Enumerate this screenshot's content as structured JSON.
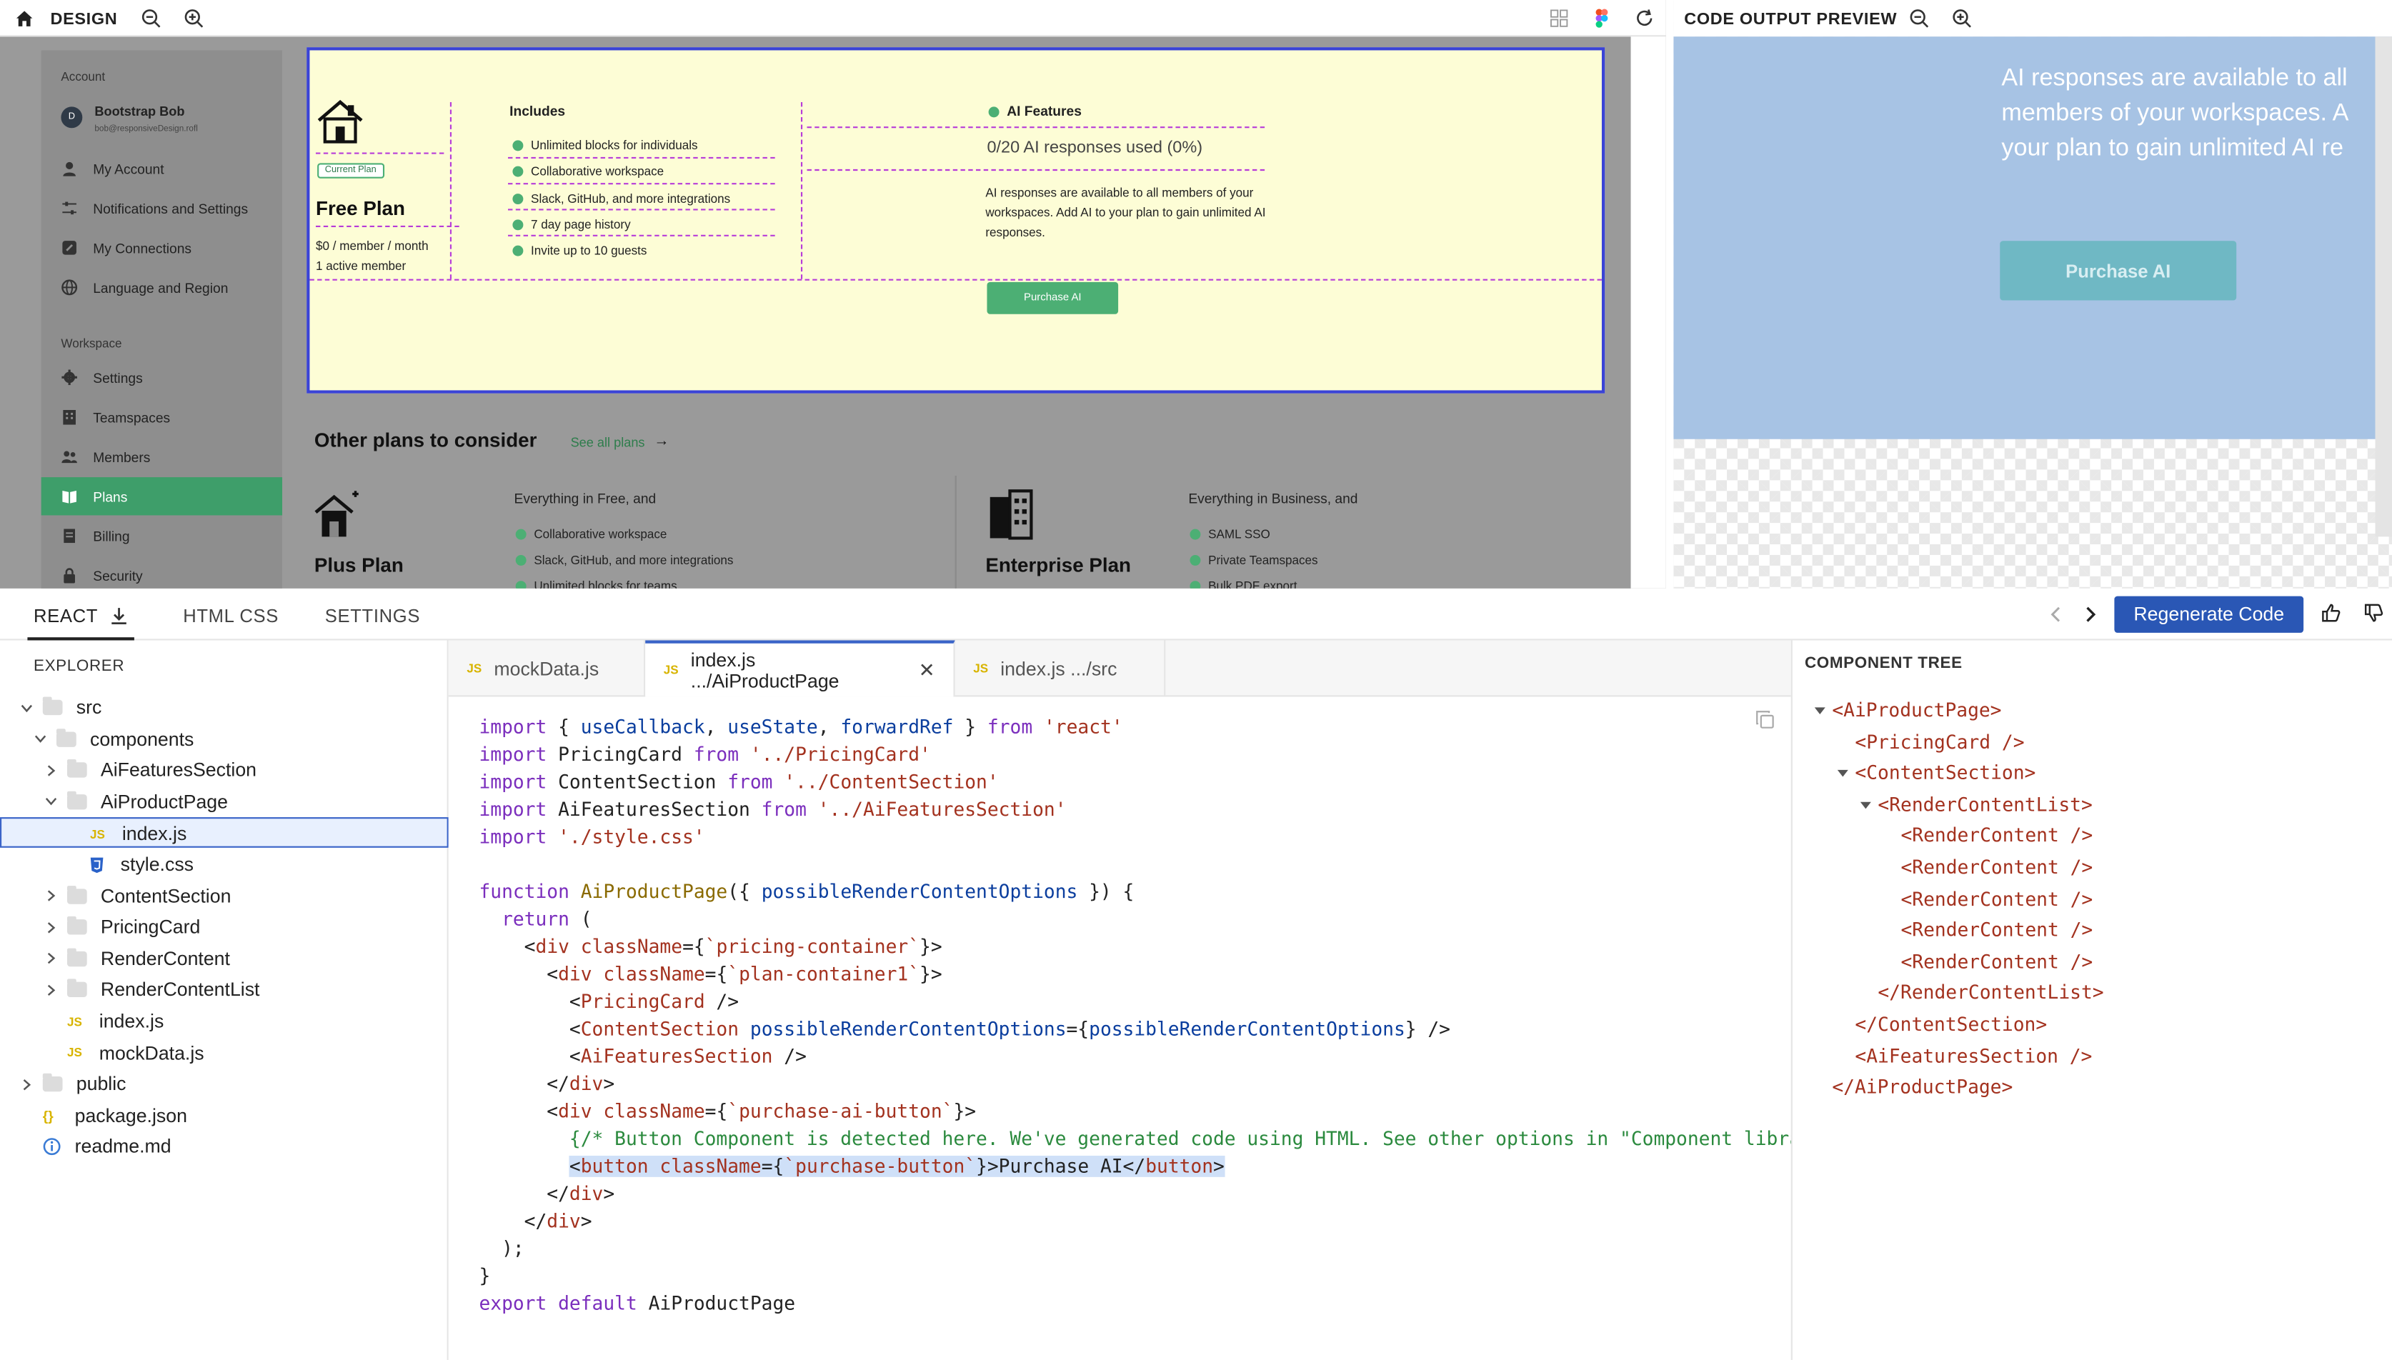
{
  "design": {
    "title": "DESIGN",
    "sidebar": {
      "account_heading": "Account",
      "user_name": "Bootstrap Bob",
      "user_email": "bob@responsiveDesign.rofl",
      "avatar_letter": "D",
      "account_items": [
        {
          "label": "My Account",
          "icon": "user-icon"
        },
        {
          "label": "Notifications and Settings",
          "icon": "sliders-icon"
        },
        {
          "label": "My Connections",
          "icon": "link-box-icon"
        },
        {
          "label": "Language and Region",
          "icon": "globe-icon"
        }
      ],
      "workspace_heading": "Workspace",
      "workspace_items": [
        {
          "label": "Settings",
          "icon": "gear-icon"
        },
        {
          "label": "Teamspaces",
          "icon": "building-icon"
        },
        {
          "label": "Members",
          "icon": "people-icon"
        },
        {
          "label": "Plans",
          "icon": "book-icon",
          "active": true
        },
        {
          "label": "Billing",
          "icon": "receipt-icon"
        },
        {
          "label": "Security",
          "icon": "lock-icon"
        }
      ]
    },
    "plan_card": {
      "badge": "Current Plan",
      "plan_name": "Free Plan",
      "price": "$0 / member / month",
      "members": "1 active member",
      "includes_title": "Includes",
      "includes": [
        "Unlimited blocks for individuals",
        "Collaborative workspace",
        "Slack, GitHub, and more integrations",
        "7 day page history",
        "Invite up to 10 guests"
      ],
      "ai_title": "AI Features",
      "ai_usage": "0/20 AI responses used (0%)",
      "ai_desc": "AI responses are available to all members of your workspaces. Add AI to your plan to gain unlimited AI responses.",
      "purchase_label": "Purchase AI"
    },
    "other_plans": {
      "title": "Other plans to consider",
      "see_all": "See all plans",
      "plus": {
        "name": "Plus Plan",
        "heading": "Everything in Free, and",
        "items": [
          "Collaborative workspace",
          "Slack, GitHub, and more integrations",
          "Unlimited blocks for teams"
        ]
      },
      "enterprise": {
        "name": "Enterprise Plan",
        "heading": "Everything in Business, and",
        "items": [
          "SAML SSO",
          "Private Teamspaces",
          "Bulk PDF export"
        ]
      }
    }
  },
  "preview": {
    "title": "CODE OUTPUT PREVIEW",
    "text_lines": [
      "AI responses are available to all",
      "members of your workspaces. A",
      "your plan to gain unlimited AI re"
    ],
    "button": "Purchase AI"
  },
  "lower_tabs": {
    "react": "REACT",
    "html_css": "HTML CSS",
    "settings": "SETTINGS",
    "regenerate": "Regenerate Code"
  },
  "explorer": {
    "title": "EXPLORER",
    "rows": [
      {
        "label": "src",
        "type": "folder",
        "level": 0,
        "open": true
      },
      {
        "label": "components",
        "type": "folder",
        "level": 1,
        "open": true
      },
      {
        "label": "AiFeaturesSection",
        "type": "folder",
        "level": 2,
        "open": false
      },
      {
        "label": "AiProductPage",
        "type": "folder",
        "level": 2,
        "open": true
      },
      {
        "label": "index.js",
        "type": "js",
        "level": 3,
        "selected": true
      },
      {
        "label": "style.css",
        "type": "css",
        "level": 3
      },
      {
        "label": "ContentSection",
        "type": "folder",
        "level": 2,
        "open": false
      },
      {
        "label": "PricingCard",
        "type": "folder",
        "level": 2,
        "open": false
      },
      {
        "label": "RenderContent",
        "type": "folder",
        "level": 2,
        "open": false
      },
      {
        "label": "RenderContentList",
        "type": "folder",
        "level": 2,
        "open": false
      },
      {
        "label": "index.js",
        "type": "js",
        "level": 2
      },
      {
        "label": "mockData.js",
        "type": "js",
        "level": 2
      },
      {
        "label": "public",
        "type": "folder",
        "level": 0,
        "open": false
      },
      {
        "label": "package.json",
        "type": "json",
        "level": 1
      },
      {
        "label": "readme.md",
        "type": "info",
        "level": 1
      }
    ]
  },
  "editor_tabs": [
    {
      "label": "mockData.js",
      "badge": "JS"
    },
    {
      "label": "index.js .../AiProductPage",
      "badge": "JS",
      "active": true
    },
    {
      "label": "index.js .../src",
      "badge": "JS"
    }
  ],
  "code_lines": [
    "import { useCallback, useState, forwardRef } from 'react'",
    "import PricingCard from '../PricingCard'",
    "import ContentSection from '../ContentSection'",
    "import AiFeaturesSection from '../AiFeaturesSection'",
    "import './style.css'",
    "",
    "function AiProductPage({ possibleRenderContentOptions }) {",
    "  return (",
    "    <div className={`pricing-container`}>",
    "      <div className={`plan-container1`}>",
    "        <PricingCard />",
    "        <ContentSection possibleRenderContentOptions={possibleRenderContentOptions} />",
    "        <AiFeaturesSection />",
    "      </div>",
    "      <div className={`purchase-ai-button`}>",
    "        {/* Button Component is detected here. We've generated code using HTML. See other options in \"Component librar",
    "        <button className={`purchase-button`}>Purchase AI</button>",
    "      </div>",
    "    </div>",
    "  );",
    "}",
    "export default AiProductPage"
  ],
  "component_tree": {
    "title": "COMPONENT TREE",
    "rows": [
      {
        "label": "<AiProductPage>",
        "level": 0,
        "toggle": true
      },
      {
        "label": "<PricingCard />",
        "level": 1
      },
      {
        "label": "<ContentSection>",
        "level": 1,
        "toggle": true
      },
      {
        "label": "<RenderContentList>",
        "level": 2,
        "toggle": true
      },
      {
        "label": "<RenderContent />",
        "level": 3
      },
      {
        "label": "<RenderContent />",
        "level": 3
      },
      {
        "label": "<RenderContent />",
        "level": 3
      },
      {
        "label": "<RenderContent />",
        "level": 3
      },
      {
        "label": "<RenderContent />",
        "level": 3
      },
      {
        "label": "</RenderContentList>",
        "level": 2
      },
      {
        "label": "</ContentSection>",
        "level": 1
      },
      {
        "label": "<AiFeaturesSection />",
        "level": 1
      },
      {
        "label": "</AiProductPage>",
        "level": 0
      }
    ]
  },
  "colors": {
    "accent": "#3a64c8",
    "green": "#4caf74",
    "selection_border": "#3a43d6",
    "guide": "#b73cd9",
    "preview_bg": "#a7c3e4",
    "preview_button": "#6fb8c4"
  }
}
